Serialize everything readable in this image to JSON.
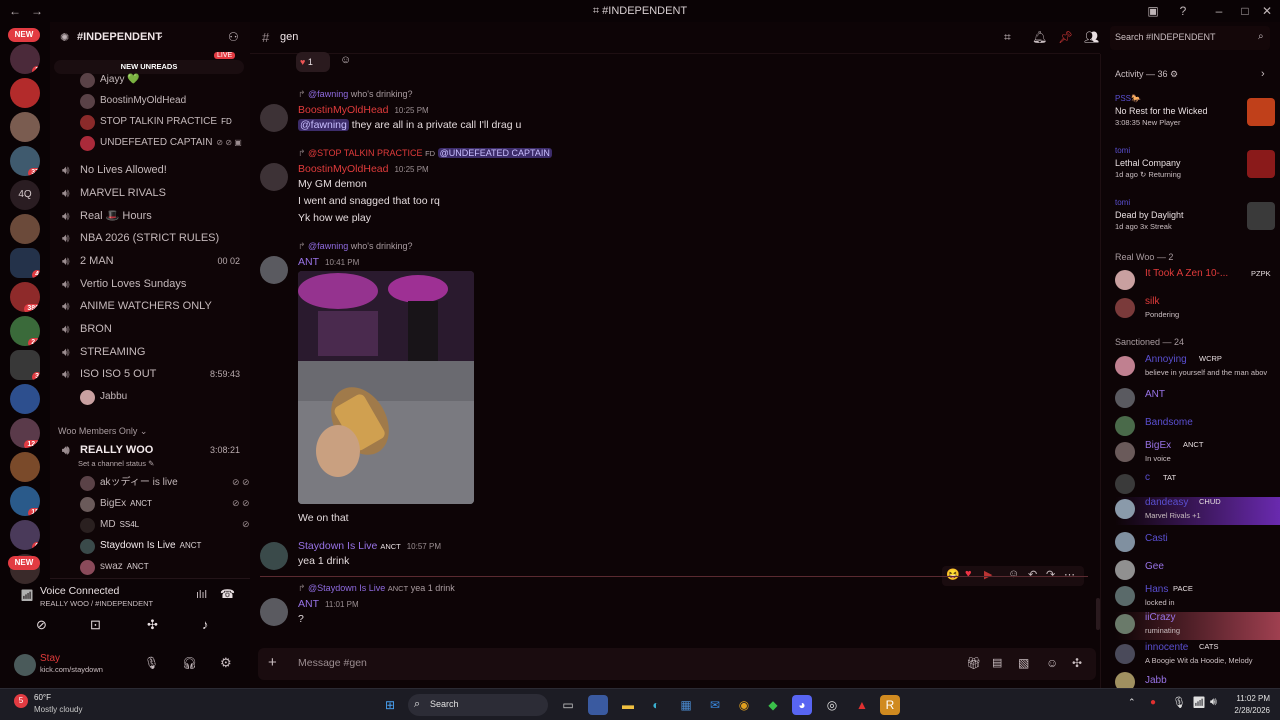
{
  "window": {
    "title": "#INDEPENDENT"
  },
  "server": {
    "name": "#INDEPENDENT",
    "new_unreads": "NEW UNREADS",
    "live_badge": "LIVE"
  },
  "guild_badges": {
    "new_top": "NEW",
    "b1": "2",
    "b2": "37",
    "label_4q": "4Q",
    "b3": "4",
    "b4": "380",
    "b5": "24",
    "b6": "3",
    "b7": "124",
    "b8": "15",
    "b9": "6",
    "new_bottom": "NEW"
  },
  "voice_top_users": [
    {
      "name": "Ajayy 💚"
    },
    {
      "name": "BoostinMyOldHead"
    },
    {
      "name": "STOP TALKIN PRACTICE",
      "tag": "FD"
    },
    {
      "name": "UNDEFEATED CAPTAIN"
    }
  ],
  "channels": [
    {
      "name": "No Lives Allowed!"
    },
    {
      "name": "MARVEL RIVALS"
    },
    {
      "name": "Real 🎩 Hours"
    },
    {
      "name": "NBA 2026 (STRICT RULES)"
    },
    {
      "name": "2 MAN",
      "right": "00  02"
    },
    {
      "name": "Vertio Loves Sundays"
    },
    {
      "name": "ANIME WATCHERS ONLY"
    },
    {
      "name": "BRON"
    },
    {
      "name": "STREAMING"
    },
    {
      "name": "ISO ISO 5 OUT",
      "right": "8:59:43"
    }
  ],
  "iso_user": "Jabbu",
  "category_woo": "Woo Members Only",
  "really_woo": {
    "name": "REALLY WOO",
    "time": "3:08:21",
    "status": "Set a channel status"
  },
  "woo_users": [
    {
      "name": "akッディー is live"
    },
    {
      "name": "BigEx",
      "tag": "ANCT"
    },
    {
      "name": "MD",
      "tag": "SS4L"
    },
    {
      "name": "Staydown Is Live",
      "tag": "ANCT"
    },
    {
      "name": "swaz",
      "tag": "ANCT"
    }
  ],
  "voice": {
    "status": "Voice Connected",
    "location": "REALLY WOO / #INDEPENDENT"
  },
  "user": {
    "name": "Stay",
    "status": "kick.com/staydown"
  },
  "chat": {
    "channel": "gen",
    "search_placeholder": "Search #INDEPENDENT",
    "reaction_count": "1",
    "input_placeholder": "Message #gen"
  },
  "messages": [
    {
      "reply_user": "@fawning",
      "reply_text": "who's drinking?",
      "author": "BoostinMyOldHead",
      "time": "10:25 PM",
      "mention": "@fawning",
      "text": "they are all in a private call I'll drag u"
    },
    {
      "reply_user": "@STOP TALKIN PRACTICE",
      "reply_tag": "FD",
      "reply_text": "@UNDEFEATED CAPTAIN",
      "author": "BoostinMyOldHead",
      "time": "10:25 PM",
      "lines": [
        "My GM demon",
        "I went and snagged that too rq",
        "Yk how we play"
      ]
    },
    {
      "reply_user": "@fawning",
      "reply_text": "who's drinking?",
      "author": "ANT",
      "time": "10:41 PM",
      "caption": "We on that"
    },
    {
      "author": "Staydown Is Live",
      "tag": "ANCT",
      "time": "10:57 PM",
      "text": "yea 1 drink"
    },
    {
      "reply_user": "@Staydown Is Live",
      "reply_tag": "ANCT",
      "reply_text": "yea 1 drink",
      "author": "ANT",
      "time": "11:01 PM",
      "text": "?"
    }
  ],
  "members": {
    "activity_header": "Activity — 36",
    "activities": [
      {
        "name": "PSS🐎",
        "game": "No Rest for the Wicked",
        "detail": "3:08:35  New Player"
      },
      {
        "name": "tomi",
        "game": "Lethal Company",
        "detail": "1d ago  ↻ Returning"
      },
      {
        "name": "tomi",
        "game": "Dead by Daylight",
        "detail": "1d ago  3x Streak"
      }
    ],
    "realwoo_header": "Real Woo — 2",
    "realwoo": [
      {
        "name": "It Took A Zen 10-...",
        "tag": "PZPK"
      },
      {
        "name": "silk",
        "status": "Pondering"
      }
    ],
    "sanctioned_header": "Sanctioned — 24",
    "sanctioned": [
      {
        "name": "Annoying",
        "tag": "WCRP",
        "status": "believe in yourself and the man abov"
      },
      {
        "name": "ANT"
      },
      {
        "name": "Bandsome"
      },
      {
        "name": "BigEx",
        "tag": "ANCT",
        "status": "In voice"
      },
      {
        "name": "c",
        "tag": "TAT"
      },
      {
        "name": "dandeasy",
        "tag": "CHUD",
        "status": "Marvel Rivals +1"
      },
      {
        "name": "Casti"
      },
      {
        "name": "Gee"
      },
      {
        "name": "Hans",
        "tag": "PACE",
        "status": "locked in"
      },
      {
        "name": "iiCrazy",
        "status": "ruminating"
      },
      {
        "name": "innocente",
        "tag": "CATS",
        "status": "A Boogie Wit da Hoodie, Melody"
      },
      {
        "name": "Jabb"
      }
    ]
  },
  "taskbar": {
    "weather_temp": "60°F",
    "weather_desc": "Mostly cloudy",
    "search": "Search",
    "time": "11:02 PM",
    "date": "2/28/2026"
  },
  "colors": {
    "accent_red": "#e23b42",
    "background": "#0d0406",
    "mention_bg": "#3c2c6a",
    "name_red": "#e03b3b",
    "name_purple": "#9873e6"
  }
}
